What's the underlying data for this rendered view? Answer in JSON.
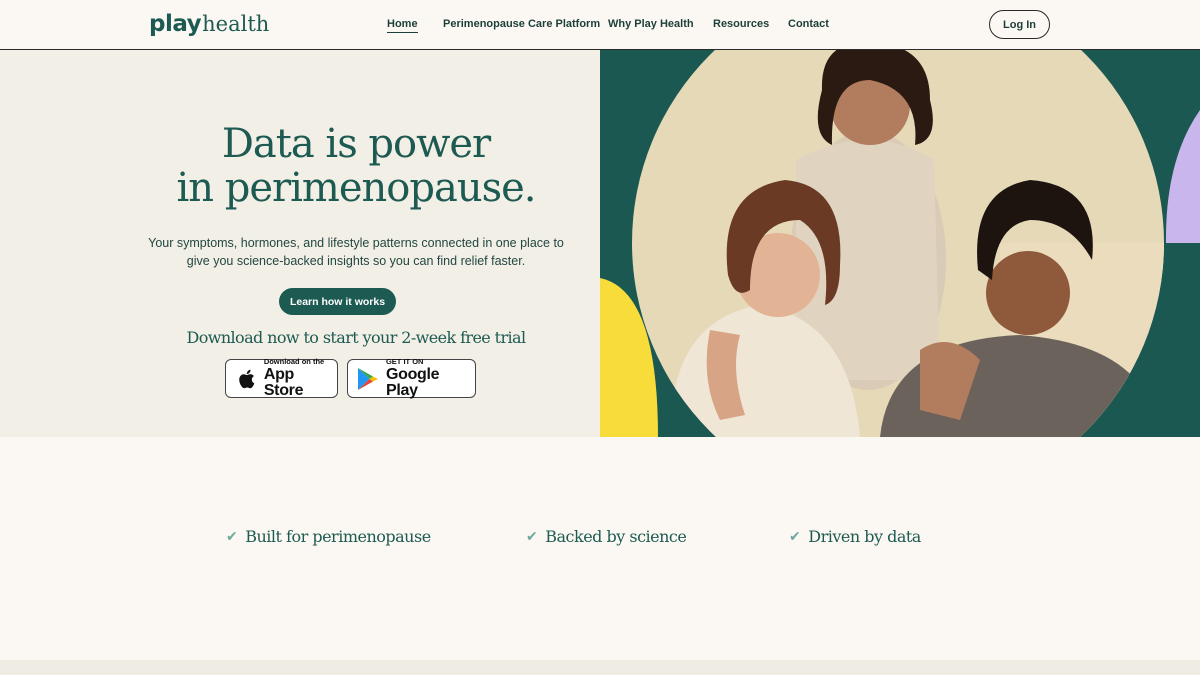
{
  "header": {
    "logo_play": "play",
    "logo_health": "health",
    "nav": [
      {
        "label": "Home",
        "active": true
      },
      {
        "label": "Perimenopause Care Platform",
        "active": false
      },
      {
        "label": "Why Play Health",
        "active": false
      },
      {
        "label": "Resources",
        "active": false
      },
      {
        "label": "Contact",
        "active": false
      }
    ],
    "login_label": "Log In"
  },
  "hero": {
    "title_line1": "Data is power",
    "title_line2": "in perimenopause.",
    "subtitle_line1": "Your symptoms, hormones, and lifestyle patterns connected in one place to",
    "subtitle_line2": "give you science-backed insights so you can find relief faster.",
    "cta_label": "Learn how it works",
    "download_text": "Download now to start your 2-week free trial",
    "app_store": {
      "small": "Download on the",
      "big": "App Store",
      "icon": "apple-icon"
    },
    "google_play": {
      "small": "GET IT ON",
      "big": "Google Play",
      "icon": "google-play-icon"
    }
  },
  "features": [
    {
      "label": "Built for perimenopause",
      "icon": "check-icon"
    },
    {
      "label": "Backed by science",
      "icon": "check-icon"
    },
    {
      "label": "Driven by data",
      "icon": "check-icon"
    }
  ],
  "colors": {
    "brand_green": "#1d5a52",
    "hero_bg": "#f2efe6",
    "page_bg": "#fbf8f3",
    "yellow": "#f7dc3a",
    "lavender": "#c9b6ec",
    "sand": "#e8dcc0"
  }
}
